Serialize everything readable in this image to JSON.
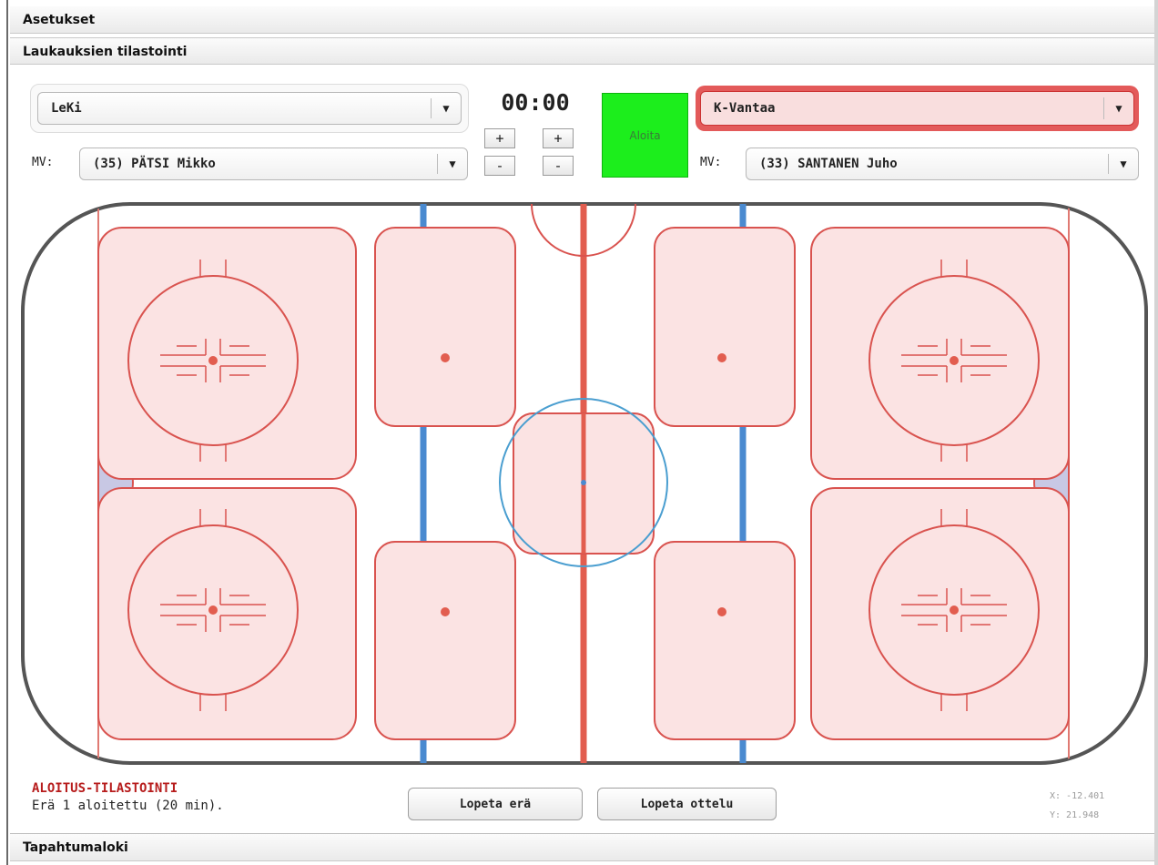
{
  "sections": {
    "settings": "Asetukset",
    "shot_stats": "Laukauksien tilastointi",
    "event_log": "Tapahtumaloki"
  },
  "home": {
    "team": "LeKi",
    "goalie_label": "MV:",
    "goalie": "(35) PÄTSI Mikko"
  },
  "away": {
    "team": "K-Vantaa",
    "goalie_label": "MV:",
    "goalie": "(33) SANTANEN Juho"
  },
  "clock": {
    "time": "00:00",
    "plus": "+",
    "minus": "-"
  },
  "start_button": "Aloita",
  "status": {
    "title": "ALOITUS-TILASTOINTI",
    "text": "Erä 1 aloitettu (20 min)."
  },
  "actions": {
    "end_period": "Lopeta erä",
    "end_game": "Lopeta ottelu"
  },
  "coords": {
    "x": "X: -12.401",
    "y": "Y: 21.948"
  },
  "icons": {
    "dropdown": "dropdown-arrow-icon"
  },
  "colors": {
    "zone_fill": "#fbe3e3",
    "zone_stroke": "#d9534f",
    "center_line": "#e25d4f",
    "blue_line": "#4a8ad0",
    "start_green": "#1cee1c",
    "away_highlight": "#e35a5a"
  }
}
